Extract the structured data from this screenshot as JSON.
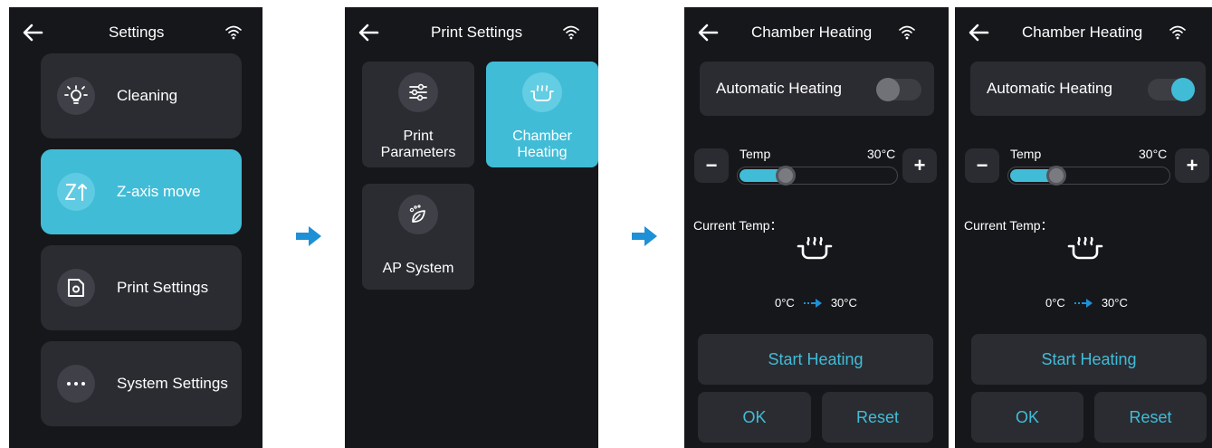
{
  "colors": {
    "accent": "#41bcd7",
    "background": "#16171b",
    "card": "#2b2c32",
    "arrow": "#1e90d6"
  },
  "screen1": {
    "title": "Settings",
    "items": [
      {
        "label": "Cleaning",
        "icon": "bulb-icon",
        "active": false
      },
      {
        "label": "Z-axis move",
        "icon": "z-axis-icon",
        "active": true
      },
      {
        "label": "Print Settings",
        "icon": "gear-doc-icon",
        "active": false
      },
      {
        "label": "System Settings",
        "icon": "more-icon",
        "active": false
      }
    ]
  },
  "screen2": {
    "title": "Print Settings",
    "tiles": [
      {
        "line1": "Print",
        "line2": "Parameters",
        "icon": "sliders-icon",
        "active": false
      },
      {
        "line1": "Chamber",
        "line2": "Heating",
        "icon": "heating-icon",
        "active": true
      },
      {
        "line1": "AP System",
        "icon": "leaf-icon",
        "active": false
      }
    ]
  },
  "screen3": {
    "title": "Chamber Heating",
    "auto_label": "Automatic Heating",
    "auto_on": false,
    "minus": "−",
    "plus": "+",
    "temp_label": "Temp",
    "temp_value": "30°C",
    "slider_level": 0.3,
    "current_label": "Current Temp：",
    "from_temp": "0°C",
    "to_temp": "30°C",
    "start_label": "Start Heating",
    "ok_label": "OK",
    "reset_label": "Reset"
  },
  "screen4": {
    "title": "Chamber Heating",
    "auto_label": "Automatic Heating",
    "auto_on": true,
    "minus": "−",
    "plus": "+",
    "temp_label": "Temp",
    "temp_value": "30°C",
    "slider_level": 0.3,
    "current_label": "Current Temp：",
    "from_temp": "0°C",
    "to_temp": "30°C",
    "start_label": "Start Heating",
    "ok_label": "OK",
    "reset_label": "Reset"
  }
}
